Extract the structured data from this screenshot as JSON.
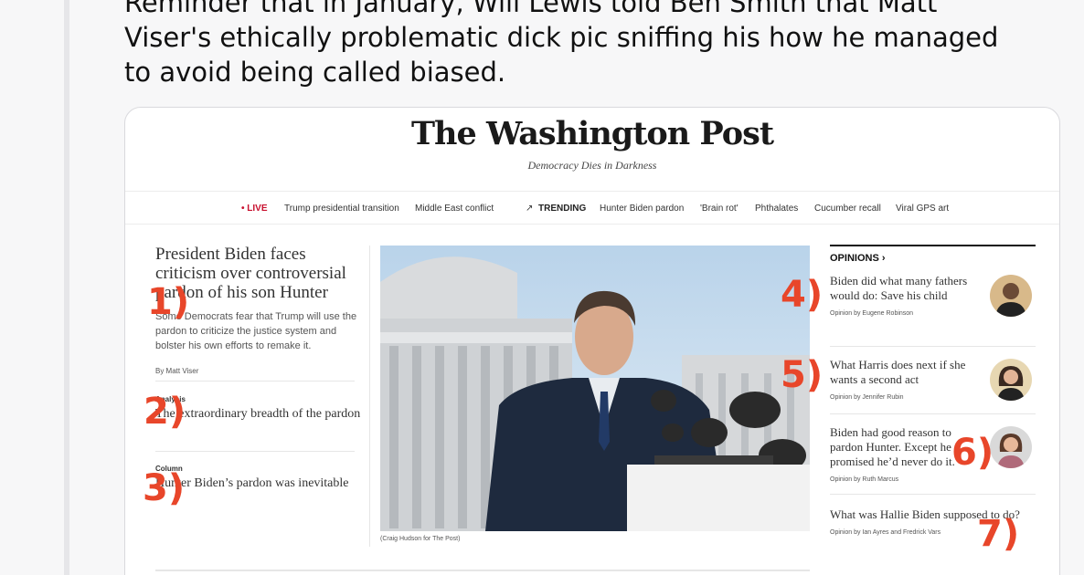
{
  "post": {
    "text": "Reminder that in January, Will Lewis told Ben Smith that Matt Viser's ethically problematic dick pic sniffing his how he managed to avoid being called biased."
  },
  "wapo": {
    "masthead": "The Washington Post",
    "tagline": "Democracy Dies in Darkness",
    "nav": {
      "live": "• LIVE",
      "items_left": [
        "Trump presidential transition",
        "Middle East conflict"
      ],
      "trending": "TRENDING",
      "items_right": [
        "Hunter Biden pardon",
        "'Brain rot'",
        "Phthalates",
        "Cucumber recall",
        "Viral GPS art"
      ]
    },
    "lead": {
      "headline": "President Biden faces criticism over controversial pardon of his son Hunter",
      "blurb": "Some Democrats fear that Trump will use the pardon to criticize the justice system and bolster his own efforts to remake it.",
      "byline": "By Matt Viser"
    },
    "story2": {
      "kicker": "Analysis",
      "headline": "The extraordinary breadth of the pardon"
    },
    "story3": {
      "kicker": "Column",
      "headline": "Hunter Biden’s pardon was inevitable"
    },
    "photo_caption": "(Craig Hudson for The Post)",
    "opinions": {
      "heading": "OPINIONS",
      "items": [
        {
          "headline": "Biden did what many fathers would do: Save his child",
          "byline": "Opinion by Eugene Robinson"
        },
        {
          "headline": "What Harris does next if she wants a second act",
          "byline": "Opinion by Jennifer Rubin"
        },
        {
          "headline": "Biden had good reason to pardon Hunter. Except he promised he’d never do it.",
          "byline": "Opinion by Ruth Marcus"
        },
        {
          "headline": "What was Hallie Biden supposed to do?",
          "byline": "Opinion by Ian Ayres and Fredrick Vars"
        }
      ]
    },
    "annotations": [
      "1)",
      "2)",
      "3)",
      "4)",
      "5)",
      "6)",
      "7)"
    ]
  }
}
